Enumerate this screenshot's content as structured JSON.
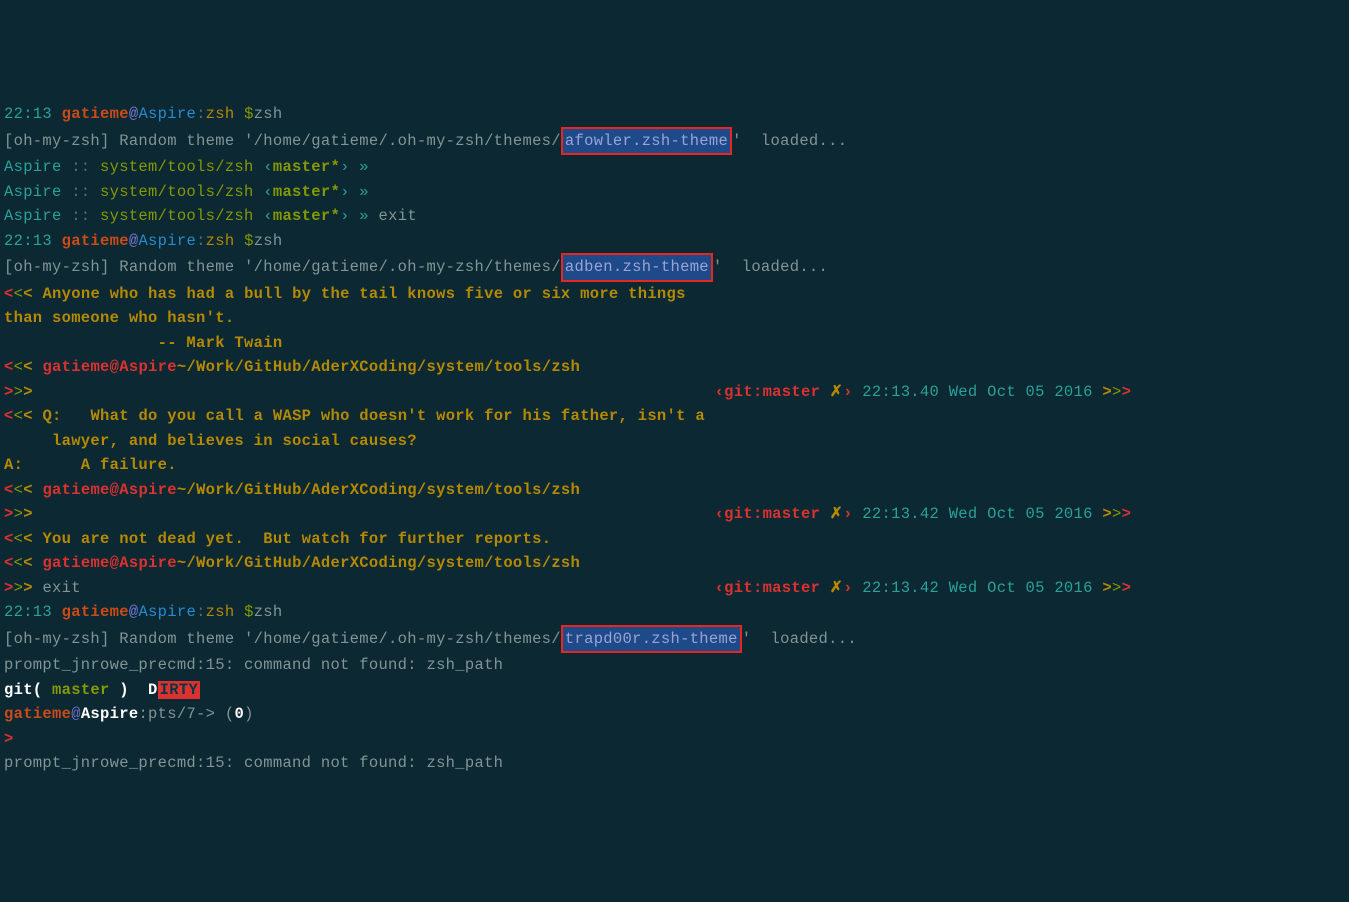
{
  "time": "22:13",
  "user": "gatieme",
  "host": "Aspire",
  "shell": "zsh",
  "themes_path": "/home/gatieme/.oh-my-zsh/themes/",
  "theme1": "afowler.zsh-theme",
  "theme2": "adben.zsh-theme",
  "theme3": "trapd00r.zsh-theme",
  "loaded": "'  loaded...",
  "cmd_zsh": "zsh",
  "cmd_exit": "exit",
  "aspire_prompt_dir": "system/tools/zsh",
  "master_star": "master*",
  "arrow": "»",
  "quote1_l1": "Anyone who has had a bull by the tail knows five or six more things",
  "quote1_l2": "than someone who hasn't.",
  "quote1_author": "-- Mark Twain",
  "cwd_path": "~/Work/GitHub/AderXCoding/system/tools/zsh",
  "git_label": "git:",
  "git_branch": "master",
  "git_x": "✗",
  "ts1": "22:13.40 Wed Oct 05 2016",
  "ts2": "22:13.42 Wed Oct 05 2016",
  "ts3": "22:13.42 Wed Oct 05 2016",
  "quote2_l1": "Q:   What do you call a WASP who doesn't work for his father, isn't a",
  "quote2_l2": "     lawyer, and believes in social causes?",
  "quote2_l3": "A:      A failure.",
  "quote3": "You are not dead yet.  But watch for further reports.",
  "err_line": "prompt_jnrowe_precmd:15: command not found: zsh_path",
  "git_paren": "git( ",
  "master_label": "master",
  "paren_close": " )  ",
  "dirty_d": "D",
  "dirty_irty": "IRTY",
  "trap_prompt": ":pts/7-> (",
  "trap_zero": "0",
  "trap_close": ")",
  "caret": ">",
  "omz": "[oh-my-zsh] Random theme '",
  "lt": "<",
  "gt": ">",
  "sep_cc": " :: "
}
